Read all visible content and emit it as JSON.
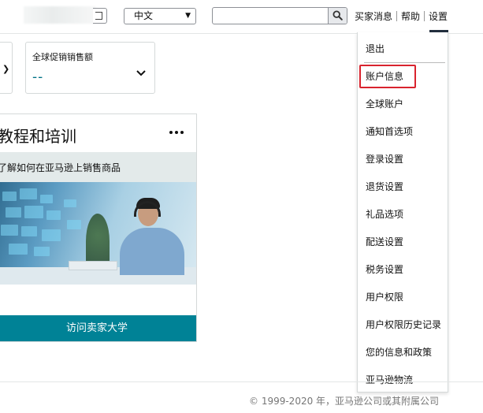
{
  "header": {
    "language": "中文",
    "search_placeholder": "",
    "nav": [
      "买家消息",
      "帮助",
      "设置"
    ]
  },
  "metric": {
    "title": "全球促销销售额",
    "value": "--"
  },
  "training": {
    "title": "教程和培训",
    "subtitle": "了解如何在亚马逊上销售商品",
    "button": "访问卖家大学"
  },
  "settings_menu": {
    "items": [
      "退出",
      "账户信息",
      "全球账户",
      "通知首选项",
      "登录设置",
      "退货设置",
      "礼品选项",
      "配送设置",
      "税务设置",
      "用户权限",
      "用户权限历史记录",
      "您的信息和政策",
      "亚马逊物流"
    ],
    "highlighted": "账户信息",
    "highlight_color": "#d9232e"
  },
  "footer": {
    "copyright": "© 1999-2020 年，亚马逊公司或其附属公司"
  },
  "colors": {
    "accent": "#008296",
    "link": "#007185",
    "highlight": "#d9232e"
  }
}
